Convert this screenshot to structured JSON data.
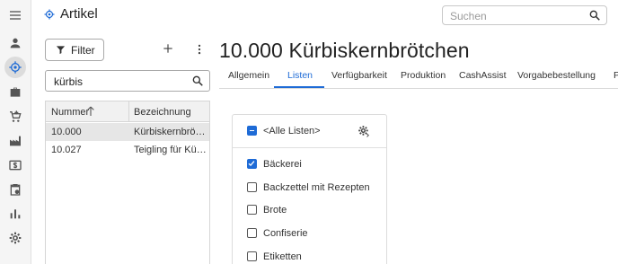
{
  "app": {
    "title": "Artikel"
  },
  "search": {
    "placeholder": "Suchen",
    "value": ""
  },
  "left_panel": {
    "filter_label": "Filter",
    "filter_value": "kürbis",
    "grid": {
      "columns": [
        "Nummer",
        "Bezeichnung"
      ],
      "sort_column": "Nummer",
      "sort_direction": "ascending",
      "rows": [
        {
          "number": "10.000",
          "name": "Kürbiskernbrötchen",
          "selected": true
        },
        {
          "number": "10.027",
          "name": "Teigling für Kürbiskernbrötchen",
          "selected": false
        }
      ]
    }
  },
  "main": {
    "title": "10.000 Kürbiskernbrötchen",
    "tabs": [
      {
        "label": "Allgemein",
        "active": false
      },
      {
        "label": "Listen",
        "active": true
      },
      {
        "label": "Verfügbarkeit",
        "active": false
      },
      {
        "label": "Produktion",
        "active": false
      },
      {
        "label": "CashAssist",
        "active": false
      },
      {
        "label": "Vorgabebestellung",
        "active": false
      },
      {
        "label": "P",
        "active": false
      }
    ],
    "lists": {
      "all_label": "<Alle Listen>",
      "all_state": "indeterminate",
      "items": [
        {
          "label": "Bäckerei",
          "checked": true
        },
        {
          "label": "Backzettel mit Rezepten",
          "checked": false
        },
        {
          "label": "Brote",
          "checked": false
        },
        {
          "label": "Confiserie",
          "checked": false
        },
        {
          "label": "Etiketten",
          "checked": false
        }
      ]
    }
  },
  "colors": {
    "accent": "#1e6bd6",
    "rail_bg": "#f5f5f5",
    "selected_row": "#e6e6e6"
  },
  "icons": {
    "rail": [
      "menu-icon",
      "user-icon",
      "article-icon",
      "briefcase-icon",
      "cart-icon",
      "factory-icon",
      "dollar-icon",
      "clipboard-icon",
      "bar-chart-icon",
      "gear-icon"
    ],
    "header": [
      "article-icon",
      "search-icon"
    ]
  }
}
